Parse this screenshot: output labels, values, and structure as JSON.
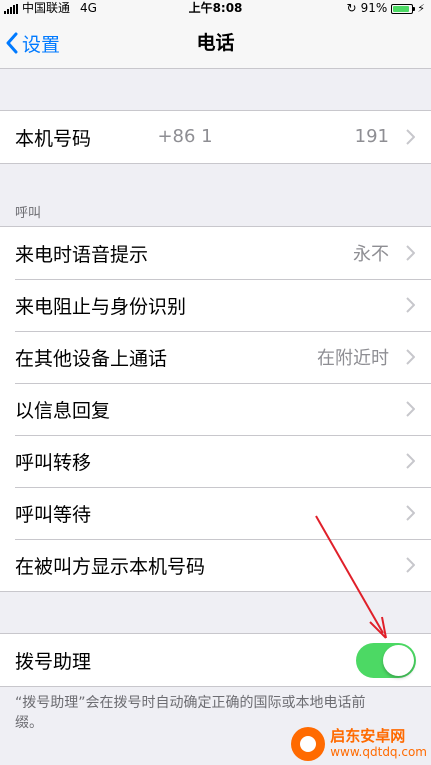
{
  "status_bar": {
    "carrier": "中国联通",
    "network": "4G",
    "time": "上午8:08",
    "battery_percent": "91%",
    "battery_level": 0.91
  },
  "nav": {
    "back_label": "设置",
    "title": "电话"
  },
  "my_number": {
    "label": "本机号码",
    "value_prefix": "+86 1",
    "value_suffix": "191"
  },
  "calls_section": {
    "header": "呼叫",
    "rows": [
      {
        "label": "来电时语音提示",
        "value": "永不"
      },
      {
        "label": "来电阻止与身份识别",
        "value": ""
      },
      {
        "label": "在其他设备上通话",
        "value": "在附近时"
      },
      {
        "label": "以信息回复",
        "value": ""
      },
      {
        "label": "呼叫转移",
        "value": ""
      },
      {
        "label": "呼叫等待",
        "value": ""
      },
      {
        "label": "在被叫方显示本机号码",
        "value": ""
      }
    ]
  },
  "dial_assist": {
    "label": "拨号助理",
    "enabled": true,
    "footer": "“拨号助理”会在拨号时自动确定正确的国际或本地电话前缀。"
  },
  "annotation": {
    "arrow_color": "#e0202a"
  },
  "watermark": {
    "name": "启东安卓网",
    "url": "www.qdtdq.com"
  },
  "colors": {
    "accent": "#007aff",
    "toggle_on": "#4cd964",
    "background": "#efeff4",
    "secondary_text": "#8e8e93"
  }
}
